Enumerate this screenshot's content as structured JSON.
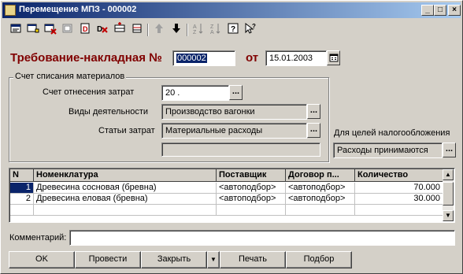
{
  "window": {
    "title": "Перемещение МПЗ - 000002"
  },
  "title_buttons": {
    "minimize": "_",
    "maximize": "□",
    "close": "×"
  },
  "toolbar": [
    "new-icon",
    "copy-icon",
    "delete-icon",
    "edit-icon",
    "print-icon",
    "mark-delete-icon",
    "insert-row-icon",
    "move-icon",
    "up-arrow-icon",
    "down-arrow-icon",
    "sort-asc-icon",
    "sort-desc-icon",
    "help-icon",
    "whats-this-icon"
  ],
  "header": {
    "doc_label": "Требование-накладная №",
    "doc_number": "000002",
    "date_label": "от",
    "date": "15.01.2003"
  },
  "group": {
    "legend": "Счет списания материалов",
    "account_label": "Счет отнесения затрат",
    "account_value": "20 .",
    "activity_label": "Виды деятельности",
    "activity_value": "Производство вагонки",
    "cost_label": "Статьи затрат",
    "cost_value": "Материальные расходы",
    "extra_value": ""
  },
  "tax": {
    "label": "Для целей налогообложения",
    "value": "Расходы принимаются"
  },
  "table": {
    "columns": [
      "N",
      "Номенклатура",
      "Поставщик",
      "Договор п...",
      "Количество"
    ],
    "rows": [
      [
        "1",
        "Древесина сосновая (бревна)",
        "<автоподбор>",
        "<автоподбор>",
        "70.000"
      ],
      [
        "2",
        "Древесина еловая (бревна)",
        "<автоподбор>",
        "<автоподбор>",
        "30.000"
      ]
    ]
  },
  "comment": {
    "label": "Комментарий:",
    "value": ""
  },
  "buttons": {
    "ok": "OK",
    "post": "Провести",
    "close": "Закрыть",
    "dropdown": "▼",
    "print": "Печать",
    "select": "Подбор"
  },
  "colors": {
    "title_start": "#0a246a",
    "title_end": "#a6caf0",
    "label_red": "#800000",
    "selection": "#0a246a"
  }
}
